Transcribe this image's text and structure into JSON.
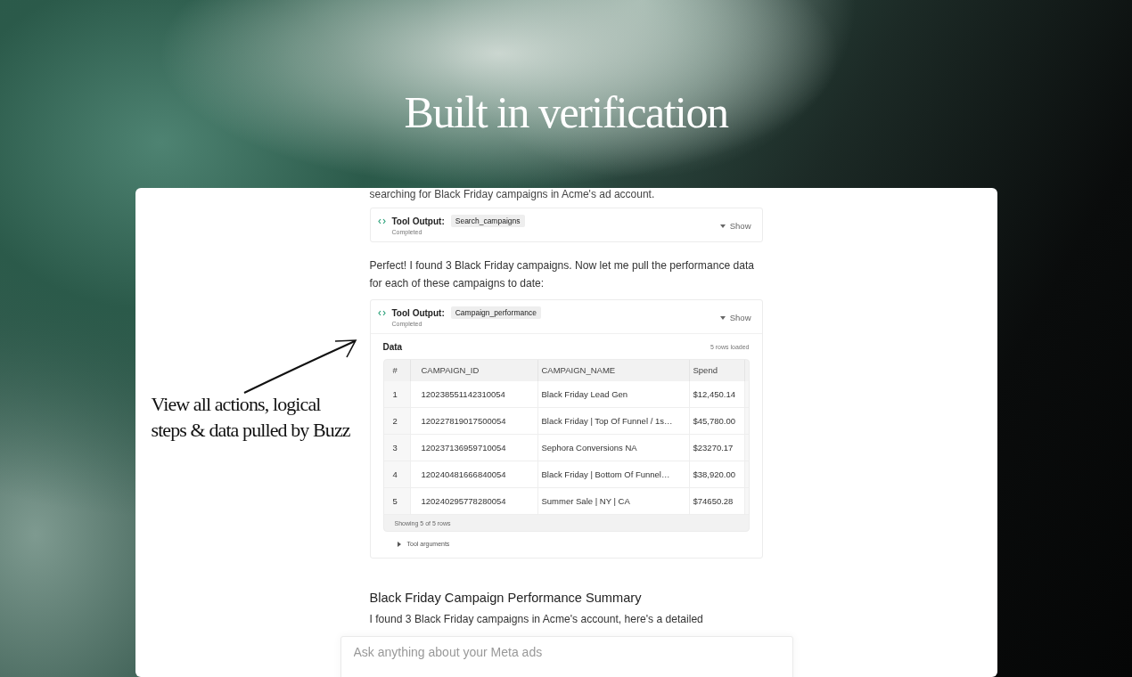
{
  "hero": {
    "title": "Built in verification"
  },
  "annotation": {
    "text": "View all actions, logical steps & data pulled by Buzz"
  },
  "messages": [
    {
      "kind": "text",
      "text": "searching for Black Friday campaigns in Acme's ad account."
    },
    {
      "kind": "tool",
      "label": "Tool Output:",
      "tool": "Search_campaigns",
      "status": "Completed",
      "toggle": "Show"
    },
    {
      "kind": "text",
      "text": "Perfect! I found 3 Black Friday campaigns. Now let me pull the performance data for each of these campaigns to date:"
    },
    {
      "kind": "tool",
      "label": "Tool Output:",
      "tool": "Campaign_performance",
      "status": "Completed",
      "toggle": "Show",
      "data": {
        "title": "Data",
        "count": "5 rows loaded",
        "columns": [
          "#",
          "CAMPAIGN_ID",
          "CAMPAIGN_NAME",
          "Spend"
        ],
        "rows": [
          [
            "1",
            "120238551142310054",
            "Black Friday Lead Gen",
            "$12,450.14"
          ],
          [
            "2",
            "120227819017500054",
            "Black Friday | Top Of Funnel / 1s…",
            "$45,780.00"
          ],
          [
            "3",
            "120237136959710054",
            "Sephora Conversions NA",
            "$23270.17"
          ],
          [
            "4",
            "120240481666840054",
            "Black Friday | Bottom Of Funnel…",
            "$38,920.00"
          ],
          [
            "5",
            "120240295778280054",
            "Summer Sale | NY | CA",
            "$74650.28"
          ]
        ],
        "footer": "Showing 5 of 5 rows",
        "arguments": "Tool arguments"
      }
    },
    {
      "kind": "heading",
      "text": "Black Friday Campaign Performance Summary"
    },
    {
      "kind": "text",
      "text": "I found 3 Black Friday campaigns in Acme's account, here's a detailed"
    }
  ],
  "input": {
    "placeholder": "Ask anything about your Meta ads"
  }
}
